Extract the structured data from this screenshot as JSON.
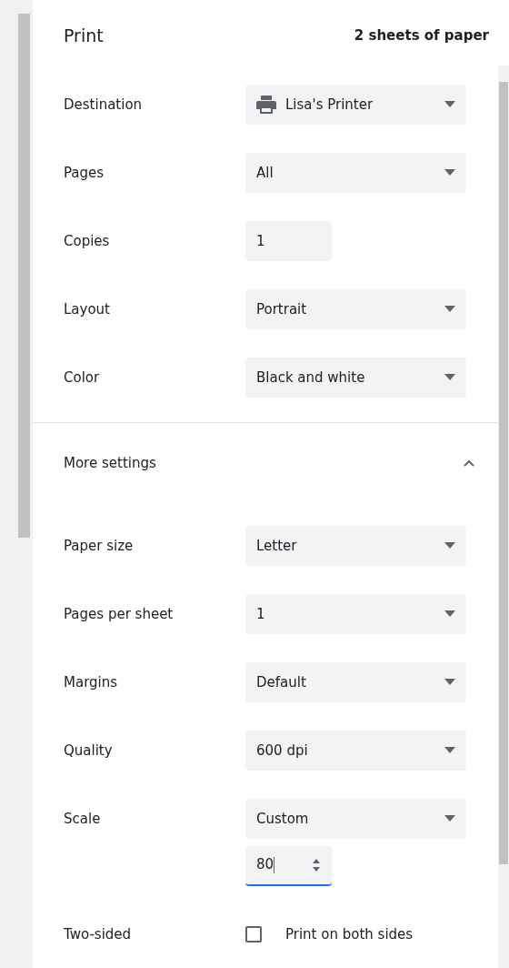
{
  "header": {
    "title": "Print",
    "sheets": "2 sheets of paper"
  },
  "settings": [
    {
      "label": "Destination",
      "kind": "printer",
      "value": "Lisa's Printer"
    },
    {
      "label": "Pages",
      "kind": "select",
      "value": "All"
    },
    {
      "label": "Copies",
      "kind": "number",
      "value": "1"
    },
    {
      "label": "Layout",
      "kind": "select",
      "value": "Portrait"
    },
    {
      "label": "Color",
      "kind": "select",
      "value": "Black and white"
    }
  ],
  "more_settings": {
    "label": "More settings",
    "expanded": true
  },
  "advanced": [
    {
      "label": "Paper size",
      "kind": "select",
      "value": "Letter"
    },
    {
      "label": "Pages per sheet",
      "kind": "select",
      "value": "1"
    },
    {
      "label": "Margins",
      "kind": "select",
      "value": "Default"
    },
    {
      "label": "Quality",
      "kind": "select",
      "value": "600 dpi"
    },
    {
      "label": "Scale",
      "kind": "select",
      "value": "Custom",
      "custom_value": "80"
    },
    {
      "label": "Two-sided",
      "kind": "checkbox",
      "checked": false,
      "text": "Print on both sides"
    }
  ]
}
